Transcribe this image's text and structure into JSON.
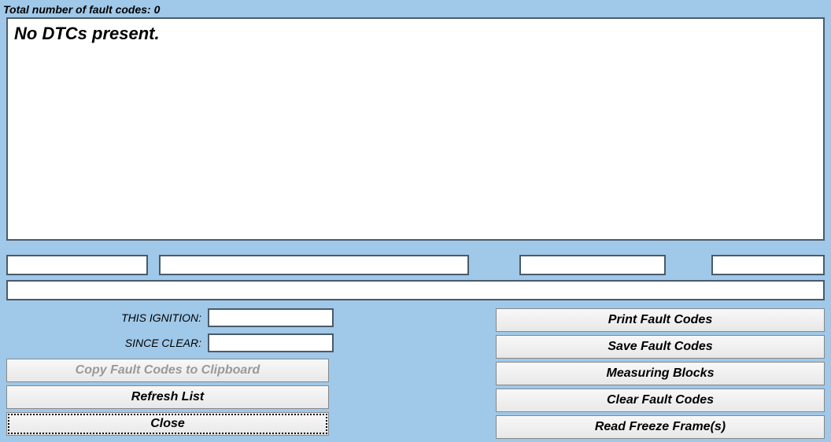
{
  "header": {
    "fault_count_label": "Total number of fault codes:  0"
  },
  "dtc": {
    "message": "No DTCs present."
  },
  "inputs": {
    "top1": "",
    "top2": "",
    "top3": "",
    "top4": "",
    "long": ""
  },
  "fields": {
    "this_ignition_label": "THIS IGNITION:",
    "this_ignition_value": "",
    "since_clear_label": "SINCE CLEAR:",
    "since_clear_value": ""
  },
  "buttons": {
    "copy_clipboard": "Copy Fault Codes to Clipboard",
    "refresh_list": "Refresh List",
    "close": "Close",
    "print_fault_codes": "Print Fault Codes",
    "save_fault_codes": "Save Fault Codes",
    "measuring_blocks": "Measuring Blocks",
    "clear_fault_codes": "Clear Fault Codes",
    "read_freeze_frames": "Read Freeze Frame(s)"
  }
}
